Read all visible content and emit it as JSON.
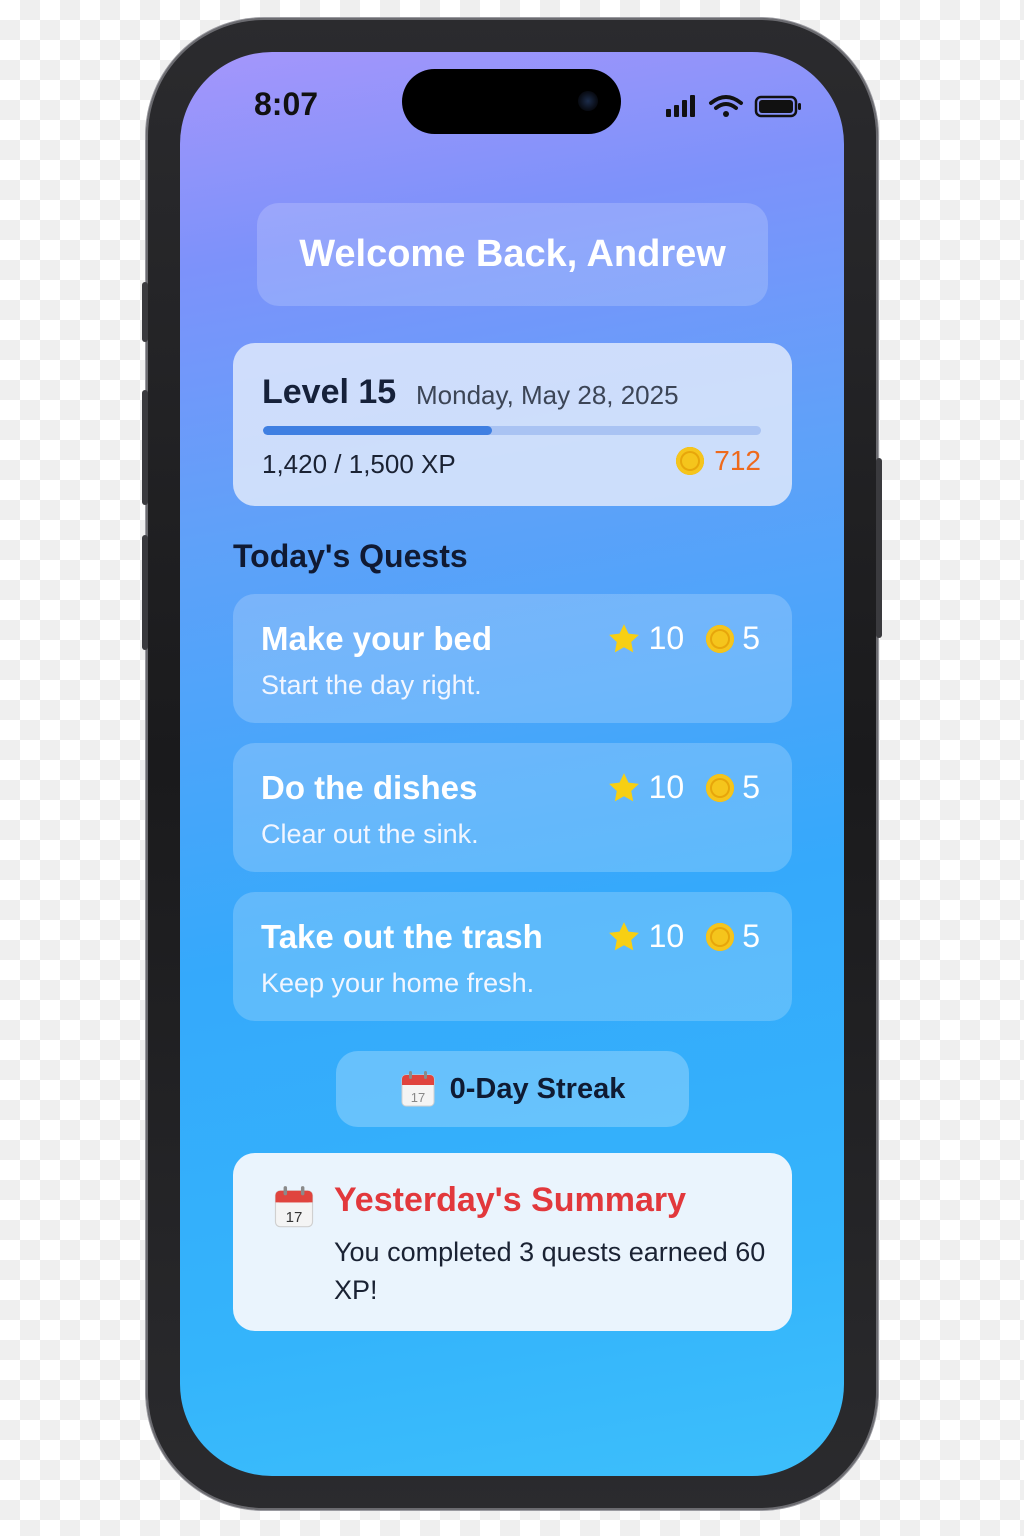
{
  "status_bar": {
    "time": "8:07"
  },
  "header": {
    "welcome": "Welcome Back, Andrew"
  },
  "level_card": {
    "level": "Level 15",
    "date": "Monday, May 28, 2025",
    "xp_text": "1,420 / 1,500 XP",
    "xp_progress": 0.46,
    "coins": "712"
  },
  "quests": {
    "title": "Today's Quests",
    "items": [
      {
        "title": "Make your bed",
        "subtitle": "Start the day right.",
        "xp": "10",
        "coins": "5"
      },
      {
        "title": "Do the dishes",
        "subtitle": "Clear out the sink.",
        "xp": "10",
        "coins": "5"
      },
      {
        "title": "Take out the trash",
        "subtitle": "Keep your home fresh.",
        "xp": "10",
        "coins": "5"
      }
    ]
  },
  "streak": {
    "label": "0-Day Streak",
    "calendar_day": "17"
  },
  "summary": {
    "title": "Yesterday's Summary",
    "text": "You completed 3 quests earneed 60 XP!",
    "calendar_day": "17"
  },
  "colors": {
    "summary_title": "#e2383c",
    "coins_count": "#ee6a1c",
    "xp_fill": "#3f7fe2"
  },
  "icons": [
    "signal-icon",
    "wifi-icon",
    "battery-icon",
    "coin-icon",
    "star-icon",
    "calendar-icon"
  ]
}
